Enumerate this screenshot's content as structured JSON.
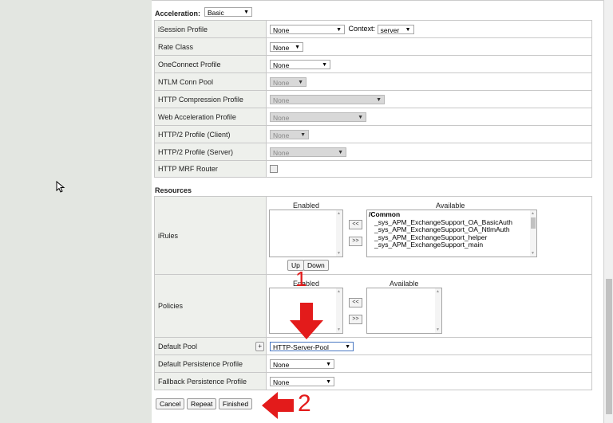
{
  "acceleration": {
    "title": "Acceleration:",
    "selected": "Basic",
    "rows": [
      {
        "label": "iSession Profile",
        "value": "None",
        "disabled": false,
        "context_label": "Context:",
        "context_value": "server"
      },
      {
        "label": "Rate Class",
        "value": "None",
        "disabled": false
      },
      {
        "label": "OneConnect Profile",
        "value": "None",
        "disabled": false
      },
      {
        "label": "NTLM Conn Pool",
        "value": "None",
        "disabled": true
      },
      {
        "label": "HTTP Compression Profile",
        "value": "None",
        "disabled": true
      },
      {
        "label": "Web Acceleration Profile",
        "value": "None",
        "disabled": true
      },
      {
        "label": "HTTP/2 Profile (Client)",
        "value": "None",
        "disabled": true
      },
      {
        "label": "HTTP/2 Profile (Server)",
        "value": "None",
        "disabled": true
      },
      {
        "label": "HTTP MRF Router",
        "value": "",
        "disabled": true,
        "checkbox": true
      }
    ]
  },
  "resources": {
    "title": "Resources",
    "irules": {
      "label": "iRules",
      "enabled_header": "Enabled",
      "available_header": "Available",
      "available_group": "/Common",
      "available_items": [
        "_sys_APM_ExchangeSupport_OA_BasicAuth",
        "_sys_APM_ExchangeSupport_OA_NtlmAuth",
        "_sys_APM_ExchangeSupport_helper",
        "_sys_APM_ExchangeSupport_main"
      ],
      "move_left": "<<",
      "move_right": ">>",
      "up_button": "Up",
      "down_button": "Down"
    },
    "policies": {
      "label": "Policies",
      "enabled_header": "Enabled",
      "available_header": "Available",
      "move_left": "<<",
      "move_right": ">>"
    },
    "default_pool": {
      "label": "Default Pool",
      "add": "+",
      "value": "HTTP-Server-Pool"
    },
    "default_persistence": {
      "label": "Default Persistence Profile",
      "value": "None"
    },
    "fallback_persistence": {
      "label": "Fallback Persistence Profile",
      "value": "None"
    }
  },
  "buttons": {
    "cancel": "Cancel",
    "repeat": "Repeat",
    "finished": "Finished"
  },
  "annotations": {
    "step1": "1",
    "step2": "2",
    "color": "#e31b1b"
  }
}
